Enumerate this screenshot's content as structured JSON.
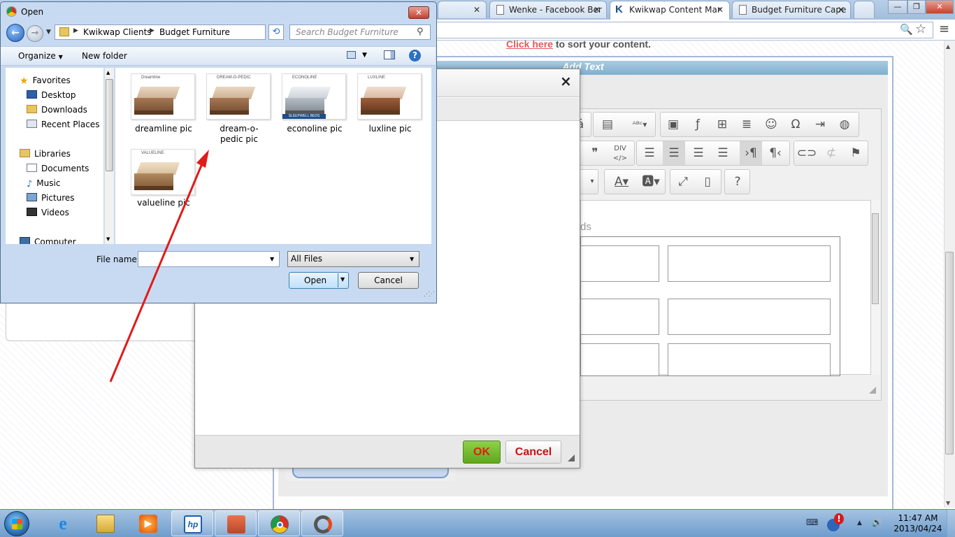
{
  "browser": {
    "tabs": [
      {
        "title": "Wenke - Facebook Ber",
        "active": false
      },
      {
        "title": "Kwikwap Content Mar",
        "active": true
      },
      {
        "title": "Budget Furniture Cape",
        "active": false
      }
    ],
    "window_buttons": {
      "minimize": "—",
      "restore": "❐",
      "close": "✕"
    }
  },
  "page": {
    "click_here": "Click here",
    "sort_text": " to sort your content.",
    "add_text_header": "Add Text",
    "placeholder_fragment": "ds",
    "toolbar_icons": {
      "row1": [
        "spellcheck-icon",
        "image-icon",
        "flash-icon",
        "table-icon",
        "horizontal-rule-icon",
        "smiley-icon",
        "omega-icon",
        "page-break-icon",
        "iframe-icon"
      ],
      "row2": [
        "blockquote-icon",
        "div-icon",
        "align-left-icon",
        "align-center-icon",
        "align-right-icon",
        "justify-icon",
        "ltr-icon",
        "rtl-icon",
        "link-icon",
        "unlink-icon",
        "anchor-icon"
      ],
      "row3": [
        "text-color-icon",
        "bg-color-icon",
        "maximize-icon",
        "show-blocks-icon",
        "help-icon"
      ]
    }
  },
  "modal": {
    "close": "×",
    "ok_label": "OK",
    "cancel_label": "Cancel"
  },
  "dialog": {
    "title": "Open",
    "close": "✕",
    "breadcrumb": [
      "Kwikwap Clients",
      "Budget Furniture"
    ],
    "search_placeholder": "Search Budget Furniture",
    "organize": "Organize",
    "new_folder": "New folder",
    "help": "?",
    "nav": {
      "favorites_header": "Favorites",
      "favorites": [
        "Desktop",
        "Downloads",
        "Recent Places"
      ],
      "libraries_header": "Libraries",
      "libraries": [
        "Documents",
        "Music",
        "Pictures",
        "Videos"
      ],
      "computer": "Computer"
    },
    "files": [
      {
        "name": "dreamline pic",
        "brand": "Dreamline"
      },
      {
        "name": "dream-o-pedic pic",
        "brand": "DREAM-O-PEDIC"
      },
      {
        "name": "econoline pic",
        "brand": "ECONOLINE"
      },
      {
        "name": "luxline pic",
        "brand": "LUXLINE"
      },
      {
        "name": "valueline pic",
        "brand": "VALUELINE"
      }
    ],
    "econoline_badge": "SLEEPWELL BEDS",
    "file_name_label": "File name:",
    "file_name_value": "",
    "file_type": "All Files",
    "open_label": "Open",
    "cancel_label": "Cancel"
  },
  "taskbar": {
    "time": "11:47 AM",
    "date": "2013/04/24",
    "hp_label": "hp"
  },
  "colors": {
    "arrow": "#e11a1a",
    "ok_green": "#5ea81d",
    "link_red": "#e45a5a",
    "header_blue": "#7fb0cf"
  }
}
